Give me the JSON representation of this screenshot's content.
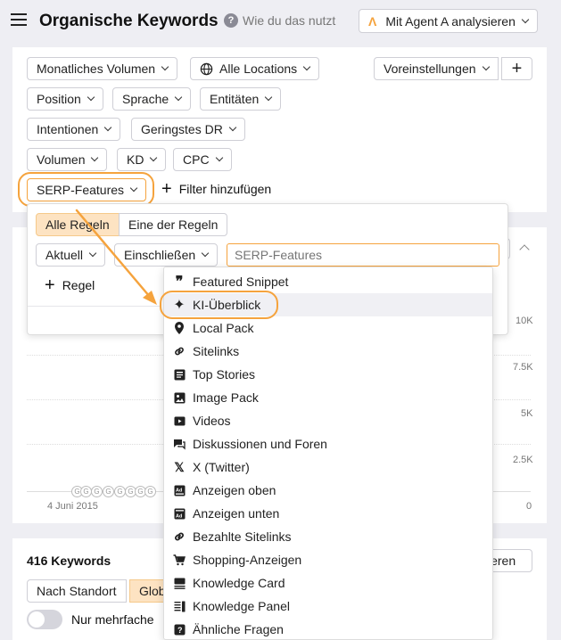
{
  "header": {
    "title": "Organische Keywords",
    "help_text": "Wie du das nutzt",
    "agent_button": "Mit Agent A analysieren",
    "agent_logo": "Λ"
  },
  "filters": {
    "monthly_volume": "Monatliches Volumen",
    "all_locations": "Alle Locations",
    "presets": "Voreinstellungen",
    "add": "+",
    "position": "Position",
    "language": "Sprache",
    "entities": "Entitäten",
    "intents": "Intentionen",
    "lowest_dr": "Geringstes DR",
    "volume": "Volumen",
    "kd": "KD",
    "cpc": "CPC",
    "serp_features": "SERP-Features",
    "add_filter": "Filter hinzufügen"
  },
  "rules_popup": {
    "all_rules": "Alle Regeln",
    "one_rule": "Eine der Regeln",
    "current": "Aktuell",
    "include": "Einschließen",
    "search_placeholder": "SERP-Features",
    "add_rule": "Regel"
  },
  "serp_menu": [
    {
      "label": "Featured Snippet",
      "icon": "quote-icon"
    },
    {
      "label": "KI-Überblick",
      "icon": "sparkle-icon"
    },
    {
      "label": "Local Pack",
      "icon": "pin-icon"
    },
    {
      "label": "Sitelinks",
      "icon": "link-icon"
    },
    {
      "label": "Top Stories",
      "icon": "news-icon"
    },
    {
      "label": "Image Pack",
      "icon": "image-icon"
    },
    {
      "label": "Videos",
      "icon": "video-icon"
    },
    {
      "label": "Diskussionen und Foren",
      "icon": "chat-icon"
    },
    {
      "label": "X (Twitter)",
      "icon": "x-icon"
    },
    {
      "label": "Anzeigen oben",
      "icon": "ad-icon"
    },
    {
      "label": "Anzeigen unten",
      "icon": "ad-icon"
    },
    {
      "label": "Bezahlte Sitelinks",
      "icon": "link-icon"
    },
    {
      "label": "Shopping-Anzeigen",
      "icon": "cart-icon"
    },
    {
      "label": "Knowledge Card",
      "icon": "card-icon"
    },
    {
      "label": "Knowledge Panel",
      "icon": "panel-icon"
    },
    {
      "label": "Ähnliche Fragen",
      "icon": "question-icon"
    }
  ],
  "chart": {
    "y_ticks": [
      "10K",
      "7.5K",
      "5K",
      "2.5K",
      "0"
    ],
    "x_label": "4 Juni 2015",
    "markers": [
      "G",
      "G",
      "G",
      "G",
      "G",
      "G",
      "G",
      "G"
    ]
  },
  "keywords": {
    "count": "416 Keywords",
    "by_location": "Nach Standort",
    "global": "Glob",
    "only_multiple": "Nur mehrfache",
    "right_button": "ieren"
  },
  "colors": {
    "accent": "#f5a33d",
    "selected_bg": "#fde3c2"
  }
}
